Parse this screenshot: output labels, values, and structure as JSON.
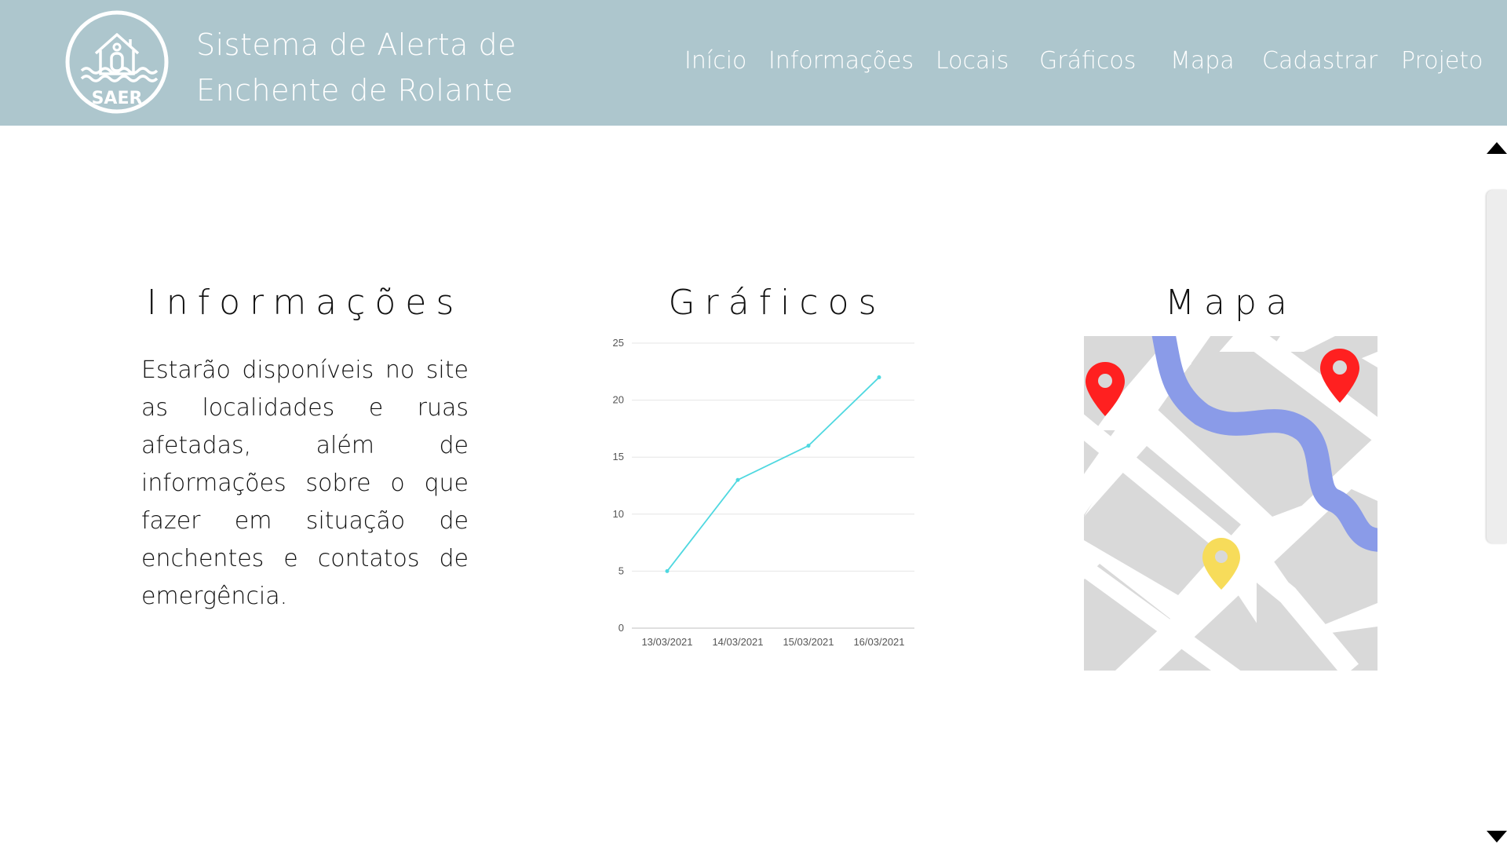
{
  "header": {
    "logo_text": "SAER",
    "title_line1": "Sistema de Alerta de",
    "title_line2": "Enchente de Rolante",
    "background": "#adc6cd"
  },
  "nav": {
    "items": [
      {
        "label": "Início"
      },
      {
        "label": "Informações"
      },
      {
        "label": "Locais"
      },
      {
        "label": "Gráficos"
      },
      {
        "label": "Mapa"
      },
      {
        "label": "Cadastrar"
      },
      {
        "label": "Projeto"
      }
    ]
  },
  "info": {
    "title": "Informações",
    "text": "Estarão disponíveis no site as localidades e ruas afetadas, além de informações sobre o que fazer em situação de enchentes e contatos de emergência."
  },
  "graficos": {
    "title": "Gráficos"
  },
  "mapa": {
    "title": "Mapa",
    "icons": [
      "map-illustration",
      "red-pin-icon",
      "yellow-pin-icon",
      "river"
    ]
  },
  "chart_data": {
    "type": "line",
    "x": [
      "13/03/2021",
      "14/03/2021",
      "15/03/2021",
      "16/03/2021"
    ],
    "series": [
      {
        "values": [
          5,
          13,
          16,
          22
        ],
        "color": "#4fd8e0"
      }
    ],
    "yticks": [
      0,
      5,
      10,
      15,
      20,
      25
    ],
    "ylim": [
      0,
      25
    ],
    "grid": true,
    "title": "",
    "xlabel": "",
    "ylabel": ""
  },
  "scrollbar": {
    "icons": [
      "scroll-up-arrow",
      "scroll-down-arrow"
    ]
  }
}
